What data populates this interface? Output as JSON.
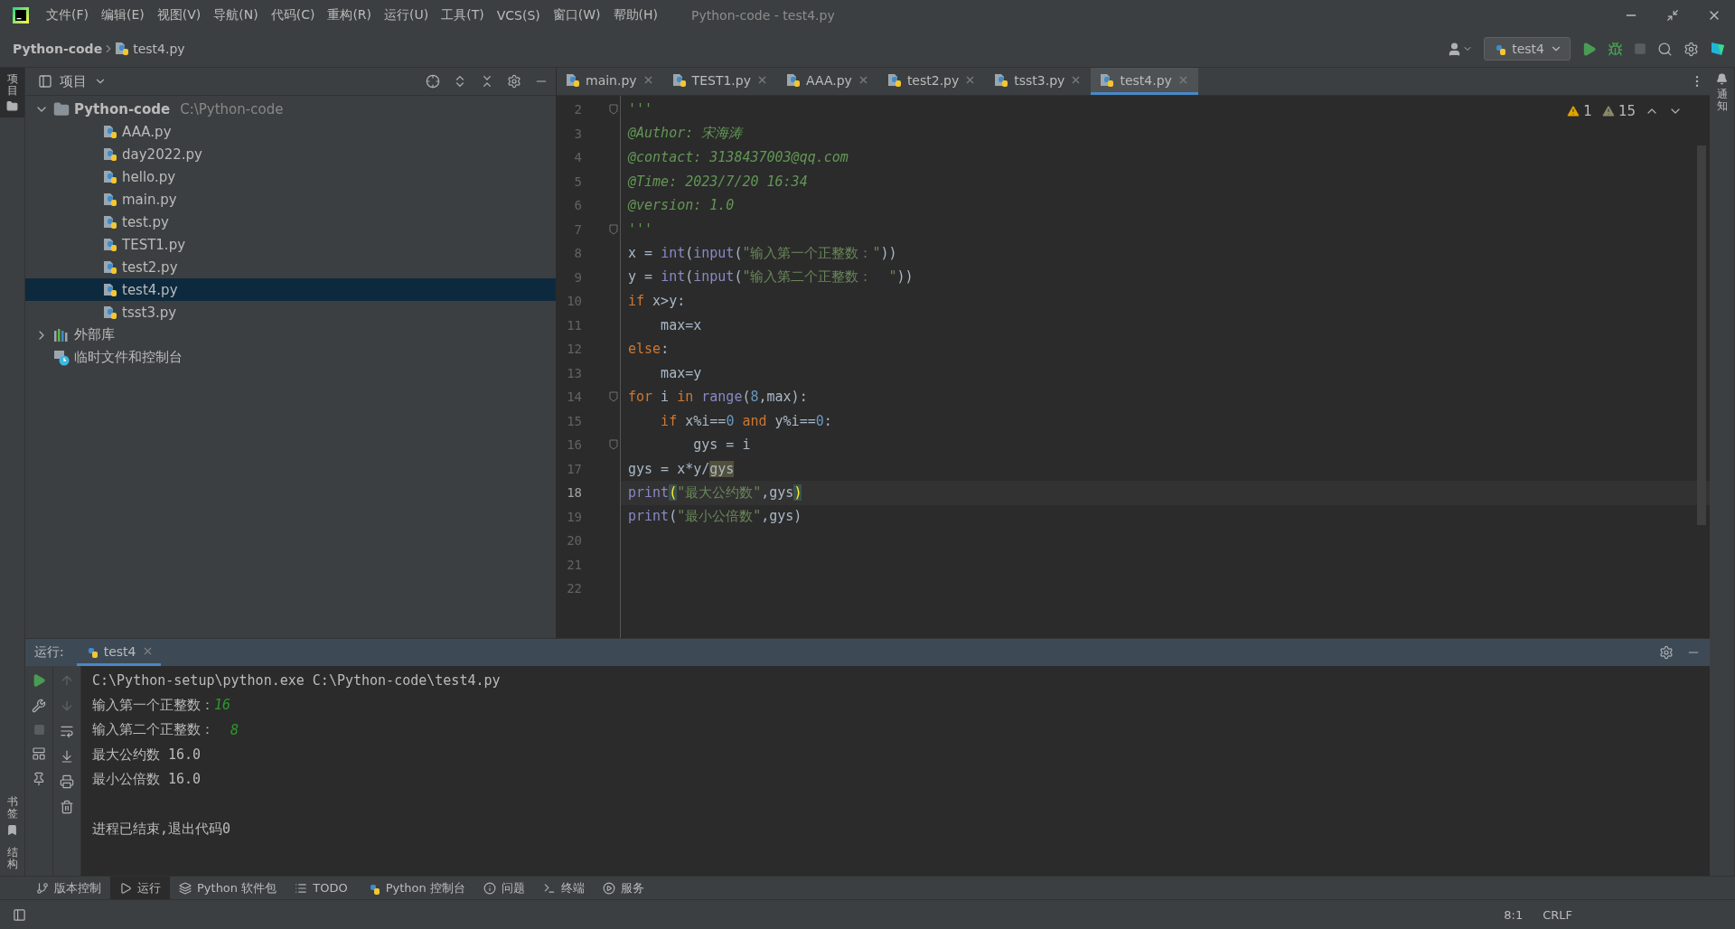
{
  "window": {
    "title": "Python-code - test4.py"
  },
  "menu": [
    "文件(F)",
    "编辑(E)",
    "视图(V)",
    "导航(N)",
    "代码(C)",
    "重构(R)",
    "运行(U)",
    "工具(T)",
    "VCS(S)",
    "窗口(W)",
    "帮助(H)"
  ],
  "breadcrumb": [
    "Python-code",
    "test4.py"
  ],
  "run_config": "test4",
  "left_strip": {
    "top": [
      {
        "label": "项目",
        "selected": true
      }
    ],
    "bottom": [
      {
        "label": "书签",
        "selected": false
      },
      {
        "label": "结构",
        "selected": false
      }
    ]
  },
  "right_strip": [
    {
      "label": "通知"
    }
  ],
  "project": {
    "title": "项目",
    "tree": [
      {
        "kind": "folder",
        "label": "Python-code",
        "path": "C:\\Python-code",
        "expanded": true,
        "children": [
          {
            "kind": "file",
            "label": "AAA.py",
            "selected": false
          },
          {
            "kind": "file",
            "label": "day2022.py",
            "selected": false
          },
          {
            "kind": "file",
            "label": "hello.py",
            "selected": false
          },
          {
            "kind": "file",
            "label": "main.py",
            "selected": false
          },
          {
            "kind": "file",
            "label": "test.py",
            "selected": false
          },
          {
            "kind": "file",
            "label": "TEST1.py",
            "selected": false
          },
          {
            "kind": "file",
            "label": "test2.py",
            "selected": false
          },
          {
            "kind": "file",
            "label": "test4.py",
            "selected": true
          },
          {
            "kind": "file",
            "label": "tsst3.py",
            "selected": false
          }
        ]
      },
      {
        "kind": "library",
        "label": "外部库",
        "expanded": false
      },
      {
        "kind": "scratch",
        "label": "临时文件和控制台"
      }
    ]
  },
  "editor_tabs": [
    {
      "label": "main.py",
      "selected": false
    },
    {
      "label": "TEST1.py",
      "selected": false
    },
    {
      "label": "AAA.py",
      "selected": false
    },
    {
      "label": "test2.py",
      "selected": false
    },
    {
      "label": "tsst3.py",
      "selected": false
    },
    {
      "label": "test4.py",
      "selected": true
    }
  ],
  "inspections": [
    {
      "kind": "warning",
      "count": "1"
    },
    {
      "kind": "weak",
      "count": "15"
    }
  ],
  "lines": [
    {
      "number": "2",
      "fold": true,
      "current": false,
      "tokens": [
        {
          "kind": "doc",
          "text": "'''"
        }
      ]
    },
    {
      "number": "3",
      "fold": false,
      "current": false,
      "tokens": [
        {
          "kind": "doc",
          "text": "@Author: 宋海涛"
        }
      ]
    },
    {
      "number": "4",
      "fold": false,
      "current": false,
      "tokens": [
        {
          "kind": "doc",
          "text": "@contact: 3138437003@qq.com"
        }
      ]
    },
    {
      "number": "5",
      "fold": false,
      "current": false,
      "tokens": [
        {
          "kind": "doc",
          "text": "@Time: 2023/7/20 16:34"
        }
      ]
    },
    {
      "number": "6",
      "fold": false,
      "current": false,
      "tokens": [
        {
          "kind": "doc",
          "text": "@version: 1.0"
        }
      ]
    },
    {
      "number": "7",
      "fold": true,
      "current": false,
      "tokens": [
        {
          "kind": "doc",
          "text": "'''"
        }
      ]
    },
    {
      "number": "8",
      "fold": false,
      "current": false,
      "tokens": [
        {
          "kind": "plain",
          "text": "x = "
        },
        {
          "kind": "fn",
          "text": "int"
        },
        {
          "kind": "plain",
          "text": "("
        },
        {
          "kind": "fn",
          "text": "input"
        },
        {
          "kind": "plain",
          "text": "("
        },
        {
          "kind": "str",
          "text": "\"输入第一个正整数：\""
        },
        {
          "kind": "plain",
          "text": "))"
        }
      ]
    },
    {
      "number": "9",
      "fold": false,
      "current": false,
      "tokens": [
        {
          "kind": "plain",
          "text": "y = "
        },
        {
          "kind": "fn",
          "text": "int"
        },
        {
          "kind": "plain",
          "text": "("
        },
        {
          "kind": "fn",
          "text": "input"
        },
        {
          "kind": "plain",
          "text": "("
        },
        {
          "kind": "str",
          "text": "\"输入第二个正整数：  \""
        },
        {
          "kind": "plain",
          "text": "))"
        }
      ]
    },
    {
      "number": "10",
      "fold": false,
      "current": false,
      "tokens": [
        {
          "kind": "kw",
          "text": "if"
        },
        {
          "kind": "plain",
          "text": " x>y:"
        }
      ]
    },
    {
      "number": "11",
      "fold": false,
      "current": false,
      "tokens": [
        {
          "kind": "plain",
          "text": "    max=x"
        }
      ]
    },
    {
      "number": "12",
      "fold": false,
      "current": false,
      "tokens": [
        {
          "kind": "kw",
          "text": "else"
        },
        {
          "kind": "plain",
          "text": ":"
        }
      ]
    },
    {
      "number": "13",
      "fold": false,
      "current": false,
      "tokens": [
        {
          "kind": "plain",
          "text": "    max=y"
        }
      ]
    },
    {
      "number": "14",
      "fold": true,
      "current": false,
      "tokens": [
        {
          "kind": "kw",
          "text": "for"
        },
        {
          "kind": "plain",
          "text": " i "
        },
        {
          "kind": "kw",
          "text": "in "
        },
        {
          "kind": "fn",
          "text": "range"
        },
        {
          "kind": "plain",
          "text": "("
        },
        {
          "kind": "num",
          "text": "8"
        },
        {
          "kind": "plain",
          "text": ",max):"
        }
      ]
    },
    {
      "number": "15",
      "fold": false,
      "current": false,
      "tokens": [
        {
          "kind": "kw",
          "text": "    if"
        },
        {
          "kind": "plain",
          "text": " x%i=="
        },
        {
          "kind": "num",
          "text": "0"
        },
        {
          "kind": "kw",
          "text": " and"
        },
        {
          "kind": "plain",
          "text": " y%i=="
        },
        {
          "kind": "num",
          "text": "0"
        },
        {
          "kind": "plain",
          "text": ":"
        }
      ]
    },
    {
      "number": "16",
      "fold": true,
      "current": false,
      "tokens": [
        {
          "kind": "plain",
          "text": "        gys = i"
        }
      ]
    },
    {
      "number": "17",
      "fold": false,
      "current": false,
      "tokens": [
        {
          "kind": "plain",
          "text": "gys = x*y/"
        },
        {
          "kind": "hl",
          "text": "gys"
        }
      ]
    },
    {
      "number": "18",
      "fold": false,
      "current": true,
      "tokens": [
        {
          "kind": "fn",
          "text": "print"
        },
        {
          "kind": "brace",
          "text": "("
        },
        {
          "kind": "str",
          "text": "\"最大公约数\""
        },
        {
          "kind": "plain",
          "text": ",gys"
        },
        {
          "kind": "brace",
          "text": ")"
        }
      ]
    },
    {
      "number": "19",
      "fold": false,
      "current": false,
      "tokens": [
        {
          "kind": "fn",
          "text": "print"
        },
        {
          "kind": "plain",
          "text": "("
        },
        {
          "kind": "str",
          "text": "\"最小公倍数\""
        },
        {
          "kind": "plain",
          "text": ",gys)"
        }
      ]
    },
    {
      "number": "20",
      "fold": false,
      "current": false
    },
    {
      "number": "21",
      "fold": false,
      "current": false
    },
    {
      "number": "22",
      "fold": false,
      "current": false
    }
  ],
  "run_panel": {
    "title": "运行:",
    "tabs": [
      {
        "label": "test4",
        "selected": true
      }
    ],
    "console": [
      {
        "kind": "out",
        "segments": [
          {
            "kind": "out",
            "text": "C:\\Python-setup\\python.exe C:\\Python-code\\test4.py"
          }
        ]
      },
      {
        "kind": "out",
        "segments": [
          {
            "kind": "out",
            "text": "输入第一个正整数："
          },
          {
            "kind": "input",
            "text": "16"
          }
        ]
      },
      {
        "kind": "out",
        "segments": [
          {
            "kind": "out",
            "text": "输入第二个正整数：  "
          },
          {
            "kind": "input",
            "text": "8"
          }
        ]
      },
      {
        "kind": "out",
        "segments": [
          {
            "kind": "out",
            "text": "最大公约数 16.0"
          }
        ]
      },
      {
        "kind": "out",
        "segments": [
          {
            "kind": "out",
            "text": "最小公倍数 16.0"
          }
        ]
      },
      {
        "kind": "exit",
        "segments": [
          {
            "kind": "out",
            "text": "进程已结束,退出代码0"
          }
        ]
      }
    ]
  },
  "tool_windows": [
    {
      "label": "版本控制",
      "selected": false
    },
    {
      "label": "运行",
      "selected": true
    },
    {
      "label": "Python 软件包",
      "selected": false
    },
    {
      "label": "TODO",
      "selected": false
    },
    {
      "label": "Python 控制台",
      "selected": false
    },
    {
      "label": "问题",
      "selected": false
    },
    {
      "label": "终端",
      "selected": false
    },
    {
      "label": "服务",
      "selected": false
    }
  ],
  "status": [
    "8:1",
    "CRLF"
  ]
}
